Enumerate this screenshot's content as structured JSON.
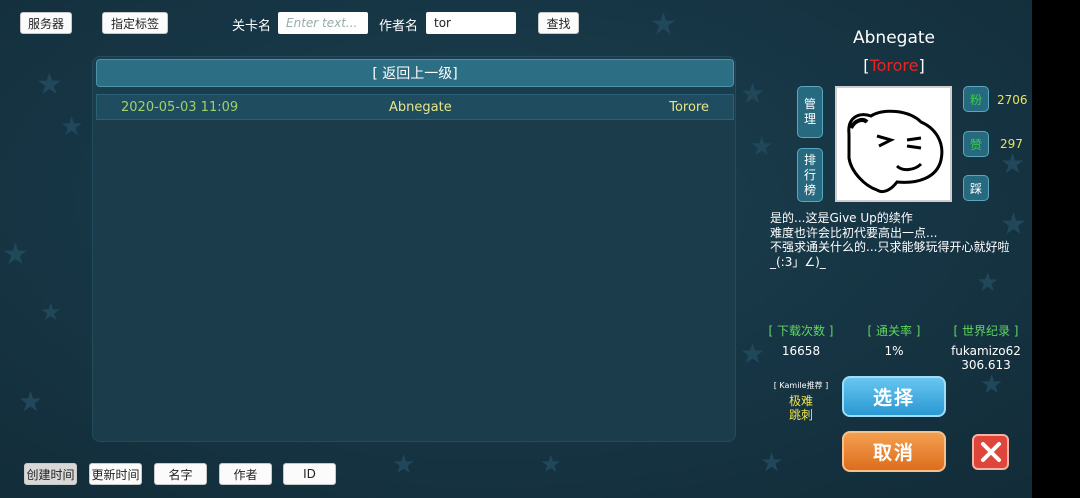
{
  "toolbar": {
    "server_label": "服务器",
    "tag_label": "指定标签",
    "level_name_label": "关卡名",
    "level_name_placeholder": "Enter text...",
    "author_label": "作者名",
    "author_value": "tor",
    "search_label": "查找"
  },
  "list": {
    "back_label": "[ 返回上一级]",
    "rows": [
      {
        "date": "2020-05-03 11:09",
        "name": "Abnegate",
        "author": "Torore"
      }
    ]
  },
  "detail": {
    "title": "Abnegate",
    "author_open": "[",
    "author": "Torore",
    "author_close": "]",
    "manage_label": [
      "管",
      "理"
    ],
    "ranking_label": [
      "排",
      "行",
      "榜"
    ],
    "fans_icon": "粉",
    "fans_count": "2706",
    "like_icon": "赞",
    "like_count": "297",
    "dislike_icon": "踩",
    "description": "是的...这是Give Up的续作\n难度也许会比初代要高出一点...\n不强求通关什么的...只求能够玩得开心就好啦\n_(:3」∠)_",
    "stats": {
      "downloads_label": "[ 下载次数 ]",
      "downloads": "16658",
      "clear_rate_label": "[ 通关率 ]",
      "clear_rate": "1%",
      "world_record_label": "[ 世界纪录 ]",
      "world_record_holder": "fukamizo62",
      "world_record_time": "306.613"
    },
    "recommend_label": "[ Kamile推荐 ]",
    "recommend_tags": [
      "极难",
      "跳刺"
    ],
    "select_label": "选择",
    "cancel_label": "取消"
  },
  "sort_buttons": [
    "创建时间",
    "更新时间",
    "名字",
    "作者",
    "ID"
  ],
  "colors": {
    "accent_blue": "#2a98d2",
    "accent_orange": "#dd6d1c",
    "close_red": "#e0453c",
    "author_red": "#e82525",
    "stat_green": "#5fd65f",
    "number_yellow": "#e8e35e"
  }
}
